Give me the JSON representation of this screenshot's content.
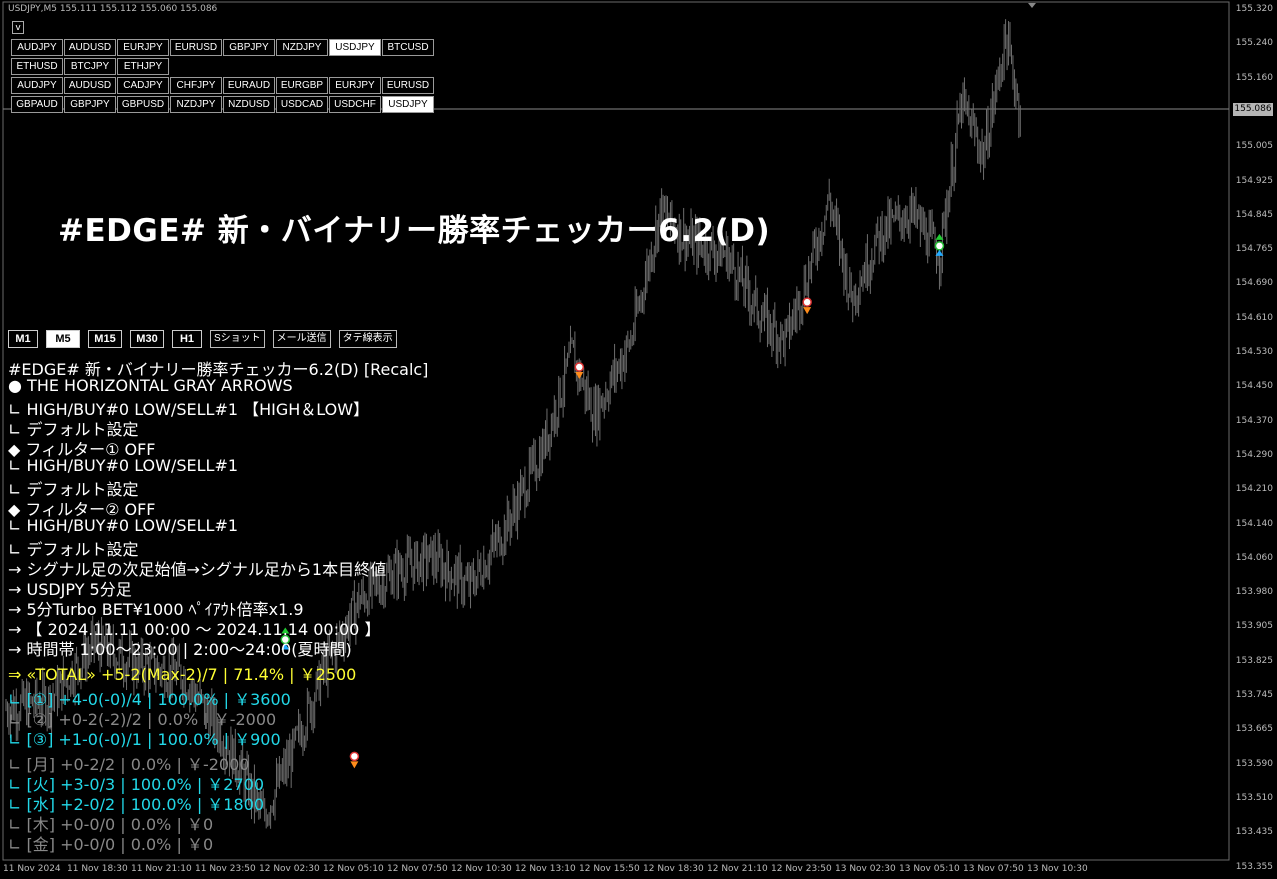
{
  "header": {
    "text": "USDJPY,M5  155.111 155.112 155.060 155.086"
  },
  "collapse_button": {
    "label": "v"
  },
  "symbol_rows": [
    {
      "items": [
        "AUDJPY",
        "AUDUSD",
        "EURJPY",
        "EURUSD",
        "GBPJPY",
        "NZDJPY",
        "USDJPY",
        "BTCUSD"
      ],
      "active": 6
    },
    {
      "items": [
        "ETHUSD",
        "BTCJPY",
        "ETHJPY"
      ],
      "active": -1
    },
    {
      "items": [
        "AUDJPY",
        "AUDUSD",
        "CADJPY",
        "CHFJPY",
        "EURAUD",
        "EURGBP",
        "EURJPY",
        "EURUSD"
      ],
      "active": -1
    },
    {
      "items": [
        "GBPAUD",
        "GBPJPY",
        "GBPUSD",
        "NZDJPY",
        "NZDUSD",
        "USDCAD",
        "USDCHF",
        "USDJPY"
      ],
      "active": 7
    }
  ],
  "title": "#EDGE# 新・バイナリー勝率チェッカー6.2(D)",
  "timeframes": [
    {
      "label": "M1",
      "active": false
    },
    {
      "label": "M5",
      "active": true
    },
    {
      "label": "M15",
      "active": false
    },
    {
      "label": "M30",
      "active": false
    },
    {
      "label": "H1",
      "active": false
    }
  ],
  "tools": [
    "Sショット",
    "メール送信",
    "タテ線表示"
  ],
  "info_lines": [
    {
      "text": "#EDGE# 新・バイナリー勝率チェッカー6.2(D)   [Recalc]",
      "color": "#ffffff"
    },
    {
      "text": "● THE HORIZONTAL GRAY ARROWS",
      "color": "#ffffff"
    },
    {
      "text": "    ∟ HIGH/BUY#0  LOW/SELL#1    【HIGH＆LOW】",
      "color": "#ffffff"
    },
    {
      "text": "    ∟ デフォルト設定",
      "color": "#ffffff"
    },
    {
      "text": "◆ フィルター① OFF",
      "color": "#ffffff"
    },
    {
      "text": "    ∟ HIGH/BUY#0  LOW/SELL#1",
      "color": "#ffffff"
    },
    {
      "text": "    ∟ デフォルト設定",
      "color": "#ffffff"
    },
    {
      "text": "◆ フィルター② OFF",
      "color": "#ffffff"
    },
    {
      "text": "    ∟ HIGH/BUY#0  LOW/SELL#1",
      "color": "#ffffff"
    },
    {
      "text": "    ∟ デフォルト設定",
      "color": "#ffffff"
    },
    {
      "text": "→ シグナル足の次足始値→シグナル足から1本目終値",
      "color": "#ffffff"
    },
    {
      "text": "→ USDJPY     5分足",
      "color": "#ffffff"
    },
    {
      "text": "→ 5分Turbo   BET¥1000   ﾍﾟｲｱｳﾄ倍率x1.9",
      "color": "#ffffff"
    },
    {
      "text": "→ 【 2024.11.11 00:00 ～ 2024.11.14 00:00 】",
      "color": "#ffffff"
    },
    {
      "text": "→ 時間帯 1:00～23:00 | 2:00～24:00(夏時間)",
      "color": "#ffffff"
    },
    {
      "text": "⇒ «TOTAL» +5-2(Max-2)/7 | 71.4% | ￥2500",
      "color": "#ffff33"
    },
    {
      "text": "    ∟ [①] +4-0(-0)/4 | 100.0% | ￥3600",
      "color": "#22d8e8"
    },
    {
      "text": "    ∟ [②] +0-2(-2)/2 | 0.0% | ￥-2000",
      "color": "#888888"
    },
    {
      "text": "    ∟ [③] +1-0(-0)/1 | 100.0% | ￥900",
      "color": "#22d8e8"
    },
    {
      "text": "    ∟ [月] +0-2/2 | 0.0% | ￥-2000",
      "color": "#888888"
    },
    {
      "text": "    ∟ [火] +3-0/3 | 100.0% | ￥2700",
      "color": "#22d8e8"
    },
    {
      "text": "    ∟ [水] +2-0/2 | 100.0% | ￥1800",
      "color": "#22d8e8"
    },
    {
      "text": "    ∟ [木] +0-0/0 | 0.0% | ￥0",
      "color": "#888888"
    },
    {
      "text": "    ∟ [金] +0-0/0 | 0.0% | ￥0",
      "color": "#888888"
    }
  ],
  "price_axis": [
    "155.320",
    "155.240",
    "155.160",
    "155.086",
    "155.005",
    "154.925",
    "154.845",
    "154.765",
    "154.690",
    "154.610",
    "154.530",
    "154.450",
    "154.370",
    "154.290",
    "154.210",
    "154.140",
    "154.060",
    "153.980",
    "153.905",
    "153.825",
    "153.745",
    "153.665",
    "153.590",
    "153.510",
    "153.435",
    "153.355"
  ],
  "current_price": "155.086",
  "time_axis": [
    "11 Nov 2024",
    "11 Nov 18:30",
    "11 Nov 21:10",
    "11 Nov 23:50",
    "12 Nov 02:30",
    "12 Nov 05:10",
    "12 Nov 07:50",
    "12 Nov 10:30",
    "12 Nov 13:10",
    "12 Nov 15:50",
    "12 Nov 18:30",
    "12 Nov 21:10",
    "12 Nov 23:50",
    "13 Nov 02:30",
    "13 Nov 05:10",
    "13 Nov 07:50",
    "13 Nov 10:30"
  ],
  "chart_data": {
    "type": "line",
    "y_min": 153.355,
    "y_max": 155.32,
    "key_points": [
      {
        "i": 0,
        "p": 153.7
      },
      {
        "i": 30,
        "p": 153.72
      },
      {
        "i": 60,
        "p": 153.85
      },
      {
        "i": 90,
        "p": 153.8
      },
      {
        "i": 120,
        "p": 153.78
      },
      {
        "i": 150,
        "p": 153.62
      },
      {
        "i": 175,
        "p": 153.45
      },
      {
        "i": 195,
        "p": 153.6
      },
      {
        "i": 215,
        "p": 153.78
      },
      {
        "i": 240,
        "p": 153.95
      },
      {
        "i": 265,
        "p": 154.02
      },
      {
        "i": 290,
        "p": 154.05
      },
      {
        "i": 315,
        "p": 153.98
      },
      {
        "i": 340,
        "p": 154.12
      },
      {
        "i": 365,
        "p": 154.3
      },
      {
        "i": 385,
        "p": 154.52
      },
      {
        "i": 400,
        "p": 154.38
      },
      {
        "i": 425,
        "p": 154.55
      },
      {
        "i": 445,
        "p": 154.85
      },
      {
        "i": 465,
        "p": 154.78
      },
      {
        "i": 490,
        "p": 154.75
      },
      {
        "i": 515,
        "p": 154.6
      },
      {
        "i": 530,
        "p": 154.55
      },
      {
        "i": 545,
        "p": 154.7
      },
      {
        "i": 560,
        "p": 154.88
      },
      {
        "i": 575,
        "p": 154.65
      },
      {
        "i": 595,
        "p": 154.8
      },
      {
        "i": 615,
        "p": 154.85
      },
      {
        "i": 635,
        "p": 154.75
      },
      {
        "i": 650,
        "p": 155.1
      },
      {
        "i": 665,
        "p": 154.98
      },
      {
        "i": 680,
        "p": 155.25
      },
      {
        "i": 690,
        "p": 155.08
      }
    ],
    "signals": [
      {
        "i": 390,
        "p": 154.49,
        "dir": "sell"
      },
      {
        "i": 545,
        "p": 154.64,
        "dir": "sell"
      },
      {
        "i": 635,
        "p": 154.77,
        "dir": "buy"
      },
      {
        "i": 190,
        "p": 153.86,
        "dir": "buy"
      },
      {
        "i": 237,
        "p": 153.59,
        "dir": "sell"
      }
    ]
  }
}
